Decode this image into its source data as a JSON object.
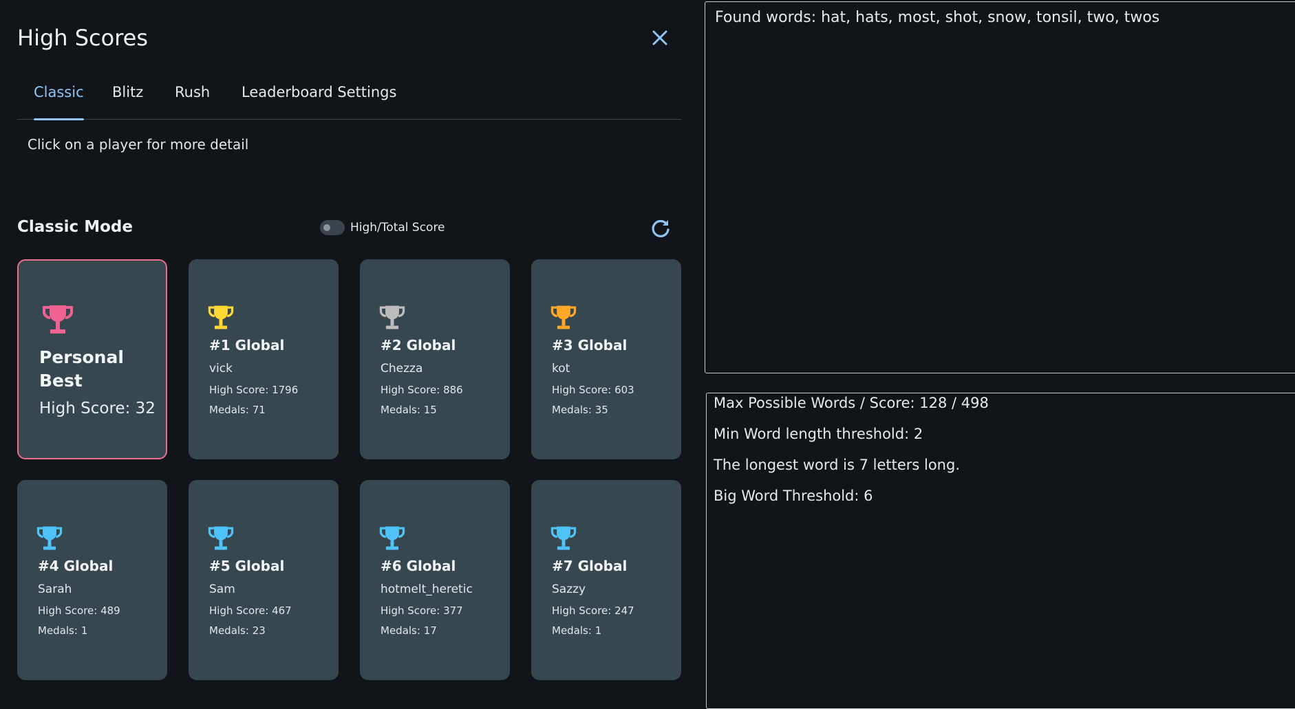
{
  "dialog": {
    "title": "High Scores",
    "tabs": [
      {
        "label": "Classic",
        "active": true
      },
      {
        "label": "Blitz",
        "active": false
      },
      {
        "label": "Rush",
        "active": false
      },
      {
        "label": "Leaderboard Settings",
        "active": false
      }
    ],
    "hint": "Click on a player for more detail",
    "mode_title": "Classic Mode",
    "toggle_label": "High/Total Score",
    "personal_best": {
      "title": "Personal Best",
      "score": "High Score: 32",
      "trophy_color": "#f06292"
    },
    "leaders": [
      {
        "rank": "#1 Global",
        "player": "vick",
        "score": "High Score: 1796",
        "medals": "Medals: 71",
        "trophy_color": "#fdd835"
      },
      {
        "rank": "#2 Global",
        "player": "Chezza",
        "score": "High Score: 886",
        "medals": "Medals: 15",
        "trophy_color": "#bdbdbd"
      },
      {
        "rank": "#3 Global",
        "player": "kot",
        "score": "High Score: 603",
        "medals": "Medals: 35",
        "trophy_color": "#ffa726"
      },
      {
        "rank": "#4 Global",
        "player": "Sarah",
        "score": "High Score: 489",
        "medals": "Medals: 1",
        "trophy_color": "#4fc3f7"
      },
      {
        "rank": "#5 Global",
        "player": "Sam",
        "score": "High Score: 467",
        "medals": "Medals: 23",
        "trophy_color": "#4fc3f7"
      },
      {
        "rank": "#6 Global",
        "player": "hotmelt_heretic",
        "score": "High Score: 377",
        "medals": "Medals: 17",
        "trophy_color": "#4fc3f7"
      },
      {
        "rank": "#7 Global",
        "player": "Sazzy",
        "score": "High Score: 247",
        "medals": "Medals: 1",
        "trophy_color": "#4fc3f7"
      }
    ]
  },
  "found_words": "Found words: hat, hats, most, shot, snow, tonsil, two, twos",
  "stats": [
    "Max Possible Words / Score: 128 / 498",
    "Min Word length threshold: 2",
    "The longest word is 7 letters long.",
    "Big Word Threshold: 6"
  ],
  "colors": {
    "accent": "#8ec5f5",
    "card_bg": "#37474f",
    "page_bg": "#11151a",
    "personal_border": "#ec6d8e"
  }
}
